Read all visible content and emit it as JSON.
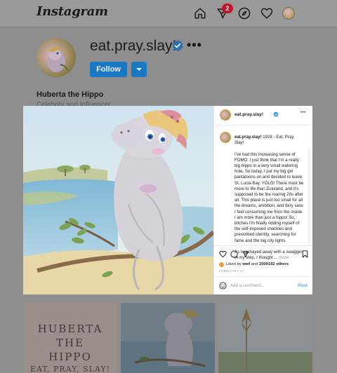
{
  "nav": {
    "logo": "Instagram",
    "notification_count": "2"
  },
  "profile": {
    "username": "eat.pray.slay!",
    "more": "•••",
    "follow_label": "Follow",
    "display_name": "Huberta the Hippo",
    "category": "Celebrity and Influencer"
  },
  "post": {
    "header_username": "eat.pray.slay!",
    "header_more": "•••",
    "caption_username": "eat.pray.slay!",
    "caption_text": "1928 - Eat, Pray, Slay!\n\nI've had this increasing sense of FOMO. I just think that I'm a really big hippo in a very small watering hole. So today, I put my big girl pantaloons on and decided to leave St. Lucia Bay. YOLO! There must be more to life than Zululand, and it's supposed to be the roaring 20s after all. This place is just too small for all the dreams, ambition, and fiery sass I feel consuming me from the inside. I am more than just a hippo! So, bitches I'm finally ridding myself of the self-imposed shackles and prescribed identity, searching for fame and the big city lights.\n\nAs I sashayed away with a swagger in my step, I thought ...",
    "more_link": "more",
    "liked_prefix": "Liked by",
    "liked_user": "wwf",
    "liked_and": "and",
    "liked_count": "2000192 others",
    "date": "FEBRUARY 27",
    "comment_placeholder": "Add a comment...",
    "post_button": "Post"
  },
  "grid": {
    "tile1_lines": [
      "HUBERTA",
      "THE",
      "HIPPO",
      "EAT, PRAY, SLAY!"
    ]
  },
  "colors": {
    "accent": "#1b78c5",
    "badge": "#c4152b",
    "verified": "#3897f0"
  },
  "icons": [
    "home-icon",
    "direct-icon",
    "explore-icon",
    "heart-icon",
    "verified-icon",
    "chevron-down-icon",
    "comment-icon",
    "share-icon",
    "bookmark-icon",
    "emoji-icon"
  ]
}
